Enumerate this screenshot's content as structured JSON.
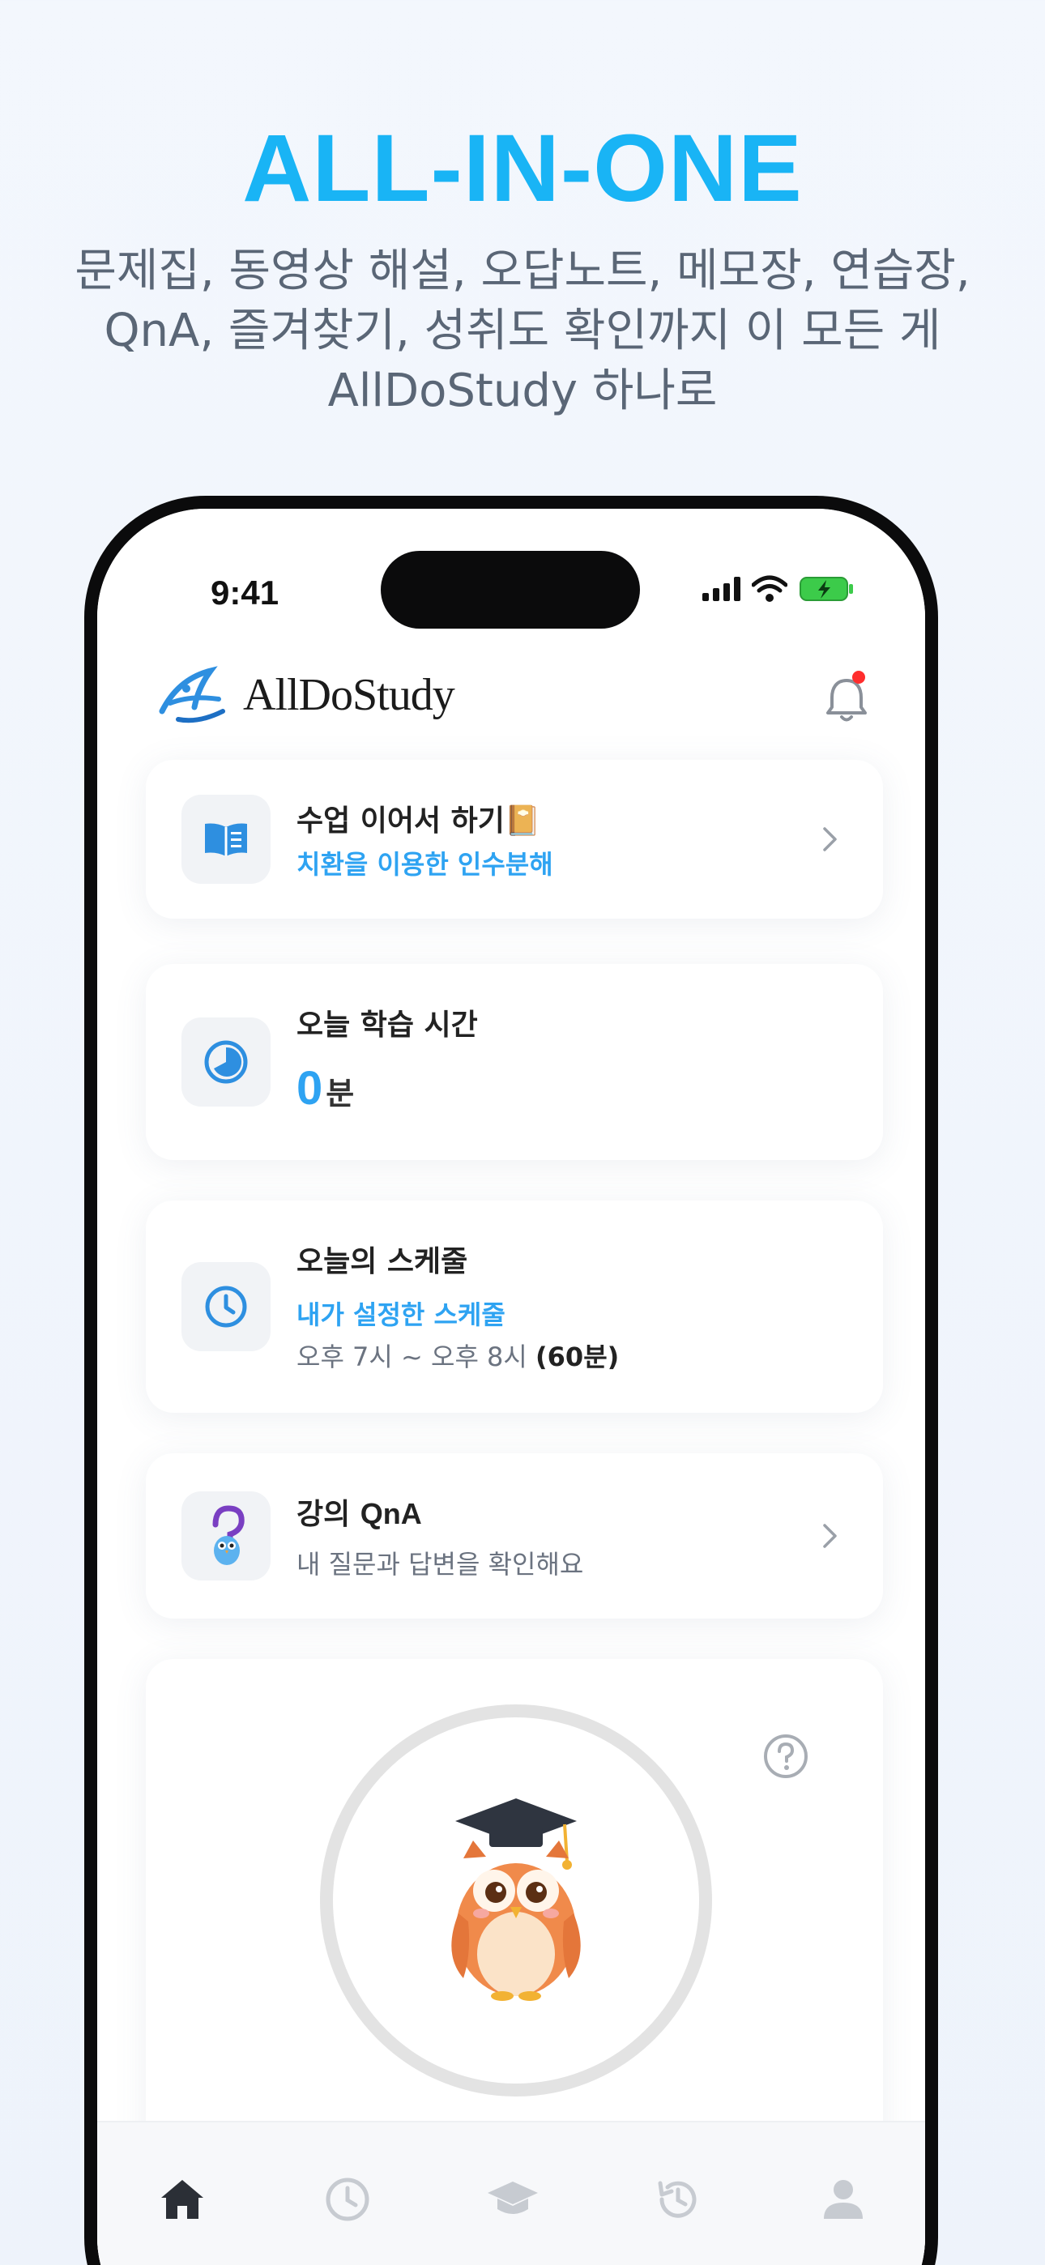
{
  "promo": {
    "headline": "ALL-IN-ONE",
    "lines": [
      "문제집, 동영상 해설, 오답노트, 메모장, 연습장,",
      "QnA, 즐겨찾기, 성취도 확인까지 이 모든 게",
      "AllDoStudy 하나로"
    ]
  },
  "status_bar": {
    "time": "9:41"
  },
  "app": {
    "name": "AllDoStudy",
    "has_notification": true
  },
  "cards": {
    "continue": {
      "title": "수업 이어서 하기📔",
      "subtitle": "치환을 이용한 인수분해",
      "icon": "book-icon"
    },
    "study_time": {
      "title": "오늘 학습 시간",
      "value": "0",
      "unit": "분",
      "icon": "timer-icon"
    },
    "schedule": {
      "title": "오늘의 스케줄",
      "subtitle": "내가 설정한 스케줄",
      "time_range": "오후 7시 ~ 오후 8시",
      "duration": "(60분)",
      "icon": "clock-icon"
    },
    "qna": {
      "title_prefix": "강의 ",
      "title_bold": "QnA",
      "subtitle": "내 질문과 답변을 확인해요",
      "icon": "owl-question-icon"
    }
  },
  "tabbar": {
    "items": [
      "home-icon",
      "clock-icon",
      "graduation-cap-icon",
      "history-icon",
      "person-icon"
    ],
    "active": 0
  },
  "colors": {
    "accent": "#2ea3f2",
    "headline": "#19b4f5",
    "owl": "#f08a4b"
  }
}
